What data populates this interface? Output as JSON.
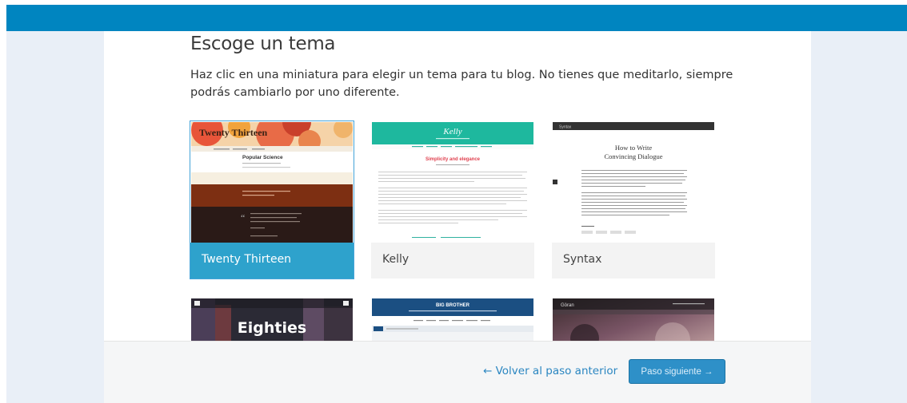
{
  "page": {
    "title": "Escoge un tema",
    "description": "Haz clic en una miniatura para elegir un tema para tu blog. No tienes que meditarlo, siempre podrás cambiarlo por uno diferente."
  },
  "themes": [
    {
      "name": "Twenty Thirteen",
      "preview_title": "Twenty Thirteen",
      "preview_post": "Popular Science",
      "selected": true
    },
    {
      "name": "Kelly",
      "preview_title": "Kelly",
      "preview_post": "Simplicity and elegance",
      "selected": false
    },
    {
      "name": "Syntax",
      "preview_title": "Syntax",
      "preview_post": "How to Write\nConvincing Dialogue",
      "selected": false
    }
  ],
  "themes_row2": [
    {
      "preview_title": "Eighties"
    },
    {
      "preview_title": "BIG BROTHER"
    },
    {
      "preview_title": "Göran"
    }
  ],
  "footer": {
    "back_label": "← Volver al paso anterior",
    "next_label": "Paso siguiente →"
  },
  "colors": {
    "topbar": "#0085c0",
    "selected_caption": "#2ea2cc",
    "link": "#2a86c1",
    "button": "#2e90c8"
  }
}
